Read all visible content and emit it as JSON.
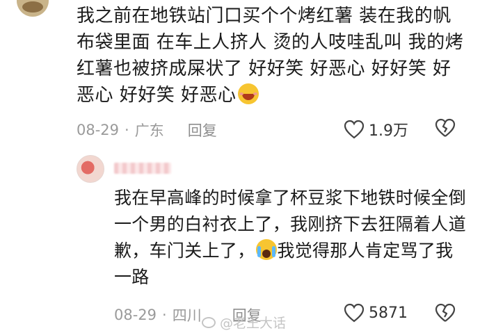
{
  "comment": {
    "text": "我之前在地铁站门口买个个烤红薯 装在我的帆布袋里面  在车上人挤人 烫的人吱哇乱叫 我的烤红薯也被挤成屎状了 好好笑 好恶心 好好笑 好恶心 好好笑 好恶心",
    "emoji": "smiling-face-icon",
    "date": "08-29",
    "location": "广东",
    "reply_label": "回复",
    "likes": "1.9万"
  },
  "reply": {
    "text_before_emoji": "我在早高峰的时候拿了杯豆浆下地铁时候全倒一个男的白衬衣上了，我刚挤下去狂隔着人道歉，车门关上了，",
    "emoji": "crying-face-icon",
    "text_after_emoji": "我觉得那人肯定骂了我一路",
    "date": "08-29",
    "location": "四川",
    "reply_label": "回复",
    "likes": "5871"
  },
  "watermark": {
    "text": "@老王大话"
  }
}
